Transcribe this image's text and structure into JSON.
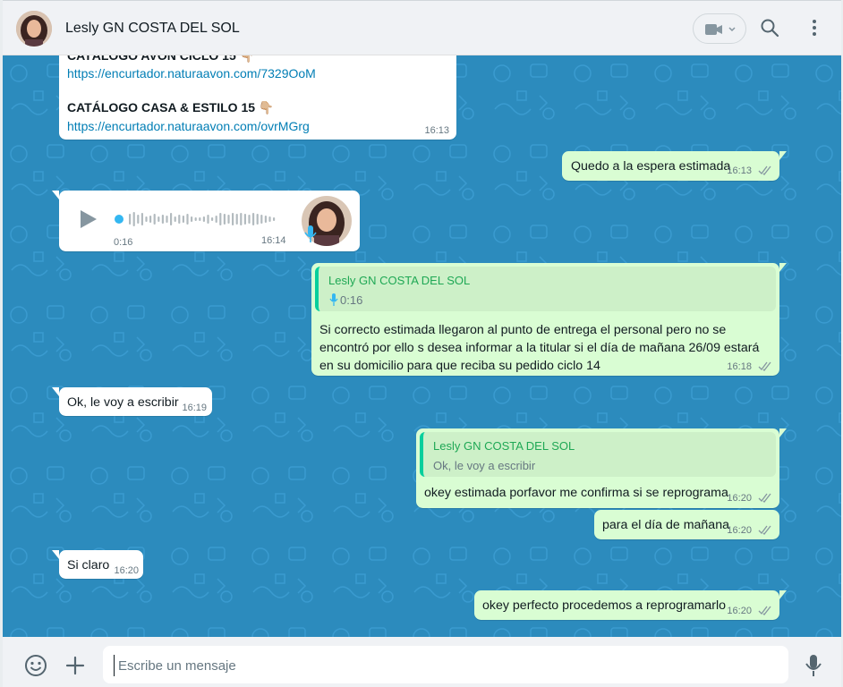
{
  "header": {
    "contact_name": "Lesly GN COSTA DEL SOL",
    "avatar_icon": "user-avatar",
    "video_icon": "video-camera-icon",
    "search_icon": "search-icon",
    "menu_icon": "more-vertical-icon"
  },
  "messages": {
    "m1": {
      "line1": "CATÁLOGO AVON CICLO 15 👇🏼",
      "link1": "https://encurtador.naturaavon.com/7329OoM",
      "line2": "CATÁLOGO CASA & ESTILO 15 👇🏼",
      "link2": "https://encurtador.naturaavon.com/ovrMGrg",
      "time": "16:13"
    },
    "m2": {
      "text": "Quedo a la espera estimada",
      "time": "16:13"
    },
    "m3": {
      "duration": "0:16",
      "time": "16:14",
      "progress": 0
    },
    "m4": {
      "quote_author": "Lesly GN COSTA DEL SOL",
      "quote_text": "0:16",
      "line1": "Si correcto estimada llegaron al punto de entrega el personal pero no se",
      "line2": "encontró por ello s desea informar a la titular si el día de mañana 26/09 estará",
      "line3": "en su domicilio para que reciba su pedido ciclo 14",
      "time": "16:18"
    },
    "m5": {
      "text": "Ok, le voy a escribir",
      "time": "16:19"
    },
    "m6": {
      "quote_author": "Lesly GN COSTA DEL SOL",
      "quote_text": "Ok, le voy a escribir",
      "text": "okey estimada porfavor me confirma si se reprograma",
      "time": "16:20"
    },
    "m7": {
      "text": "para el día de mañana",
      "time": "16:20"
    },
    "m8": {
      "text": "Si claro",
      "time": "16:20"
    },
    "m9": {
      "text": "okey perfecto procedemos a reprogramarlo",
      "time": "16:20"
    }
  },
  "footer": {
    "placeholder": "Escribe un mensaje",
    "emoji_icon": "emoji-icon",
    "attach_icon": "plus-icon",
    "mic_icon": "microphone-icon"
  },
  "colors": {
    "chat_background": "#2c8bbd",
    "outgoing_bubble": "#d9fdd3",
    "incoming_bubble": "#ffffff",
    "accent": "#06cf9c",
    "link": "#027eb5"
  }
}
